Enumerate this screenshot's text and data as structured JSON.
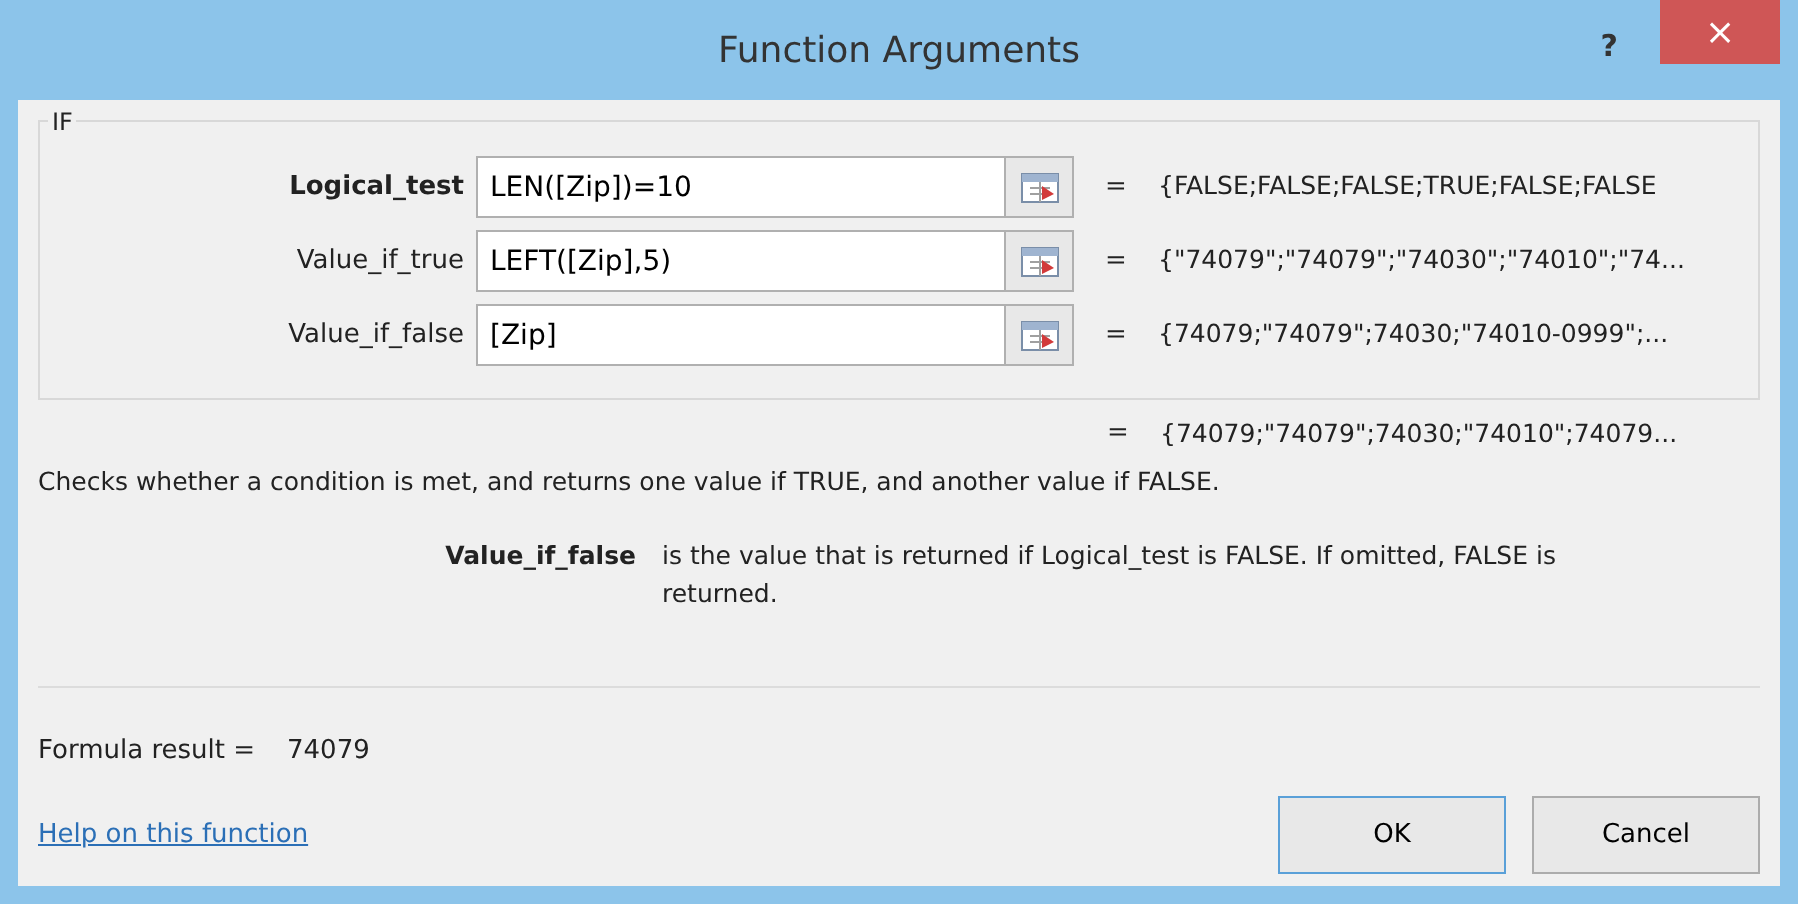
{
  "window": {
    "title": "Function Arguments",
    "help_button": "?",
    "close_button": "×"
  },
  "function_name": "IF",
  "arguments": [
    {
      "label": "Logical_test",
      "value": "LEN([Zip])=10",
      "equals": "=",
      "result": "{FALSE;FALSE;FALSE;TRUE;FALSE;FALSE"
    },
    {
      "label": "Value_if_true",
      "value": "LEFT([Zip],5)",
      "equals": "=",
      "result": "{\"74079\";\"74079\";\"74030\";\"74010\";\"74..."
    },
    {
      "label": "Value_if_false",
      "value": "[Zip]",
      "equals": "=",
      "result": "{74079;\"74079\";74030;\"74010-0999\";..."
    }
  ],
  "overall_result": {
    "equals": "=",
    "value": "{74079;\"74079\";74030;\"74010\";74079..."
  },
  "description": "Checks whether a condition is met, and returns one value if TRUE, and another value if FALSE.",
  "argument_help": {
    "name": "Value_if_false",
    "text": "is the value that is returned if Logical_test is FALSE. If omitted, FALSE is returned."
  },
  "formula_result": {
    "label": "Formula result =",
    "value": "74079"
  },
  "help_link": "Help on this function",
  "buttons": [
    {
      "label": "OK",
      "default": true
    },
    {
      "label": "Cancel",
      "default": false
    }
  ]
}
